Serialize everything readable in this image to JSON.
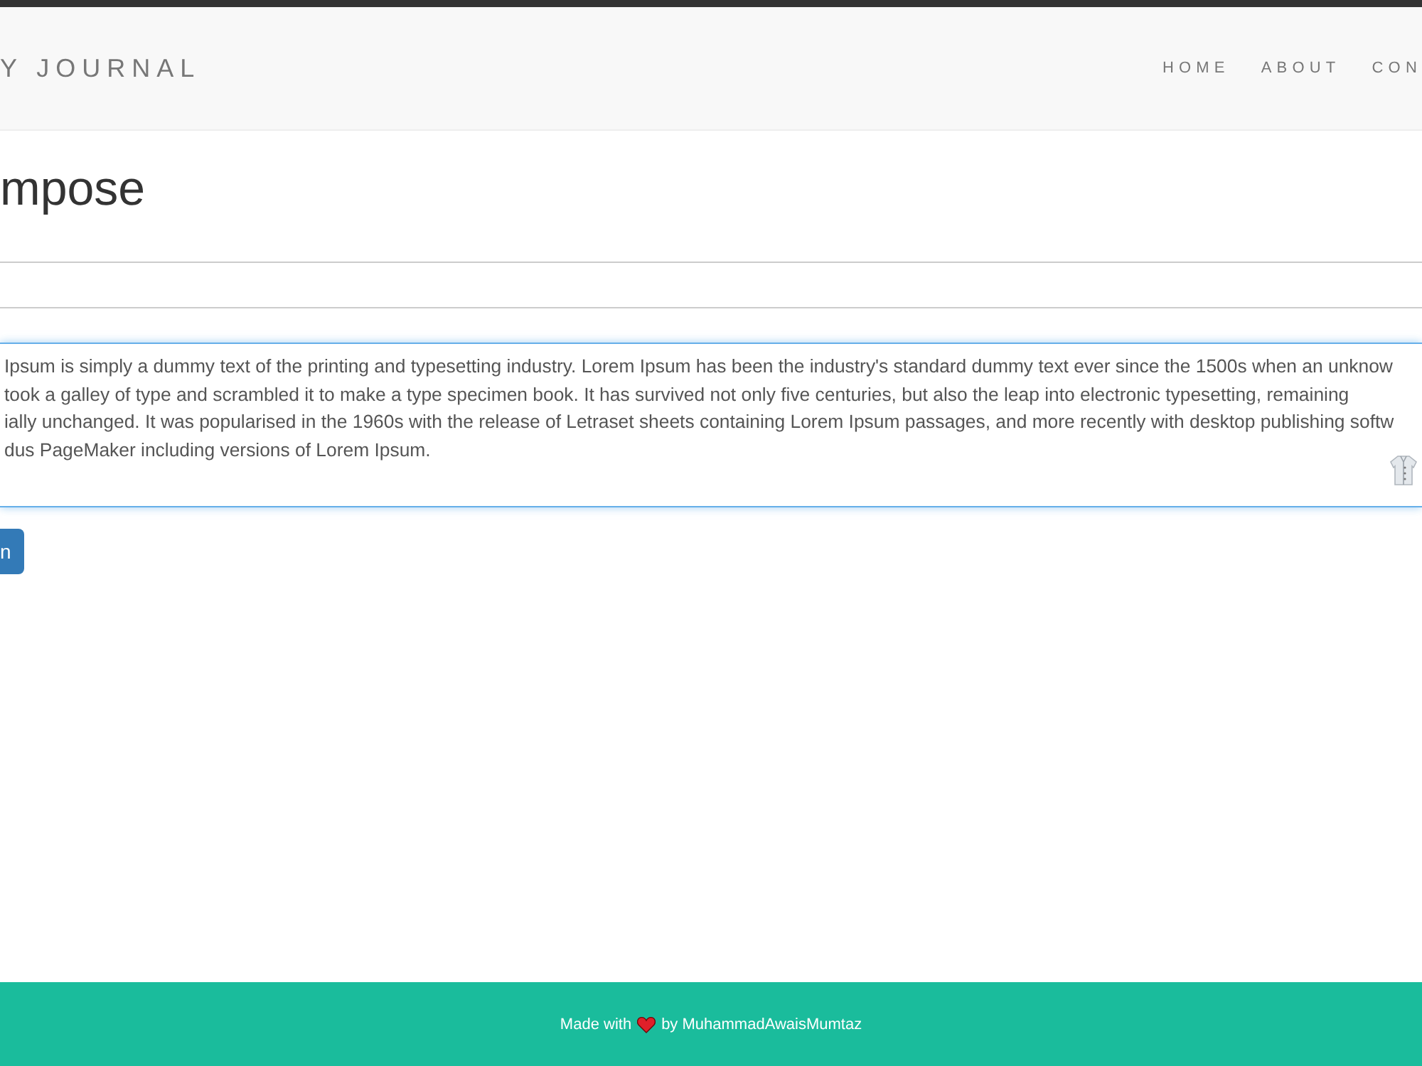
{
  "navbar": {
    "brand": "Y JOURNAL",
    "links": [
      {
        "label": "HOME"
      },
      {
        "label": "ABOUT"
      },
      {
        "label": "CON"
      }
    ]
  },
  "heading": "mpose",
  "compose": {
    "body_lines": [
      "Ipsum is simply a dummy text of the printing and typesetting industry. Lorem Ipsum has been the industry's standard dummy text ever since the 1500s when an unknow",
      "took a galley of type and scrambled it to make a type specimen book. It has survived not only five centuries, but also the leap into electronic typesetting, remaining",
      "ially unchanged. It was popularised in the 1960s with the release of Letraset sheets containing Lorem Ipsum passages, and more recently with desktop publishing softw",
      "dus PageMaker including versions of Lorem Ipsum."
    ]
  },
  "button": "n",
  "footer": {
    "before": "Made with",
    "after": "by MuhammadAwaisMumtaz"
  }
}
